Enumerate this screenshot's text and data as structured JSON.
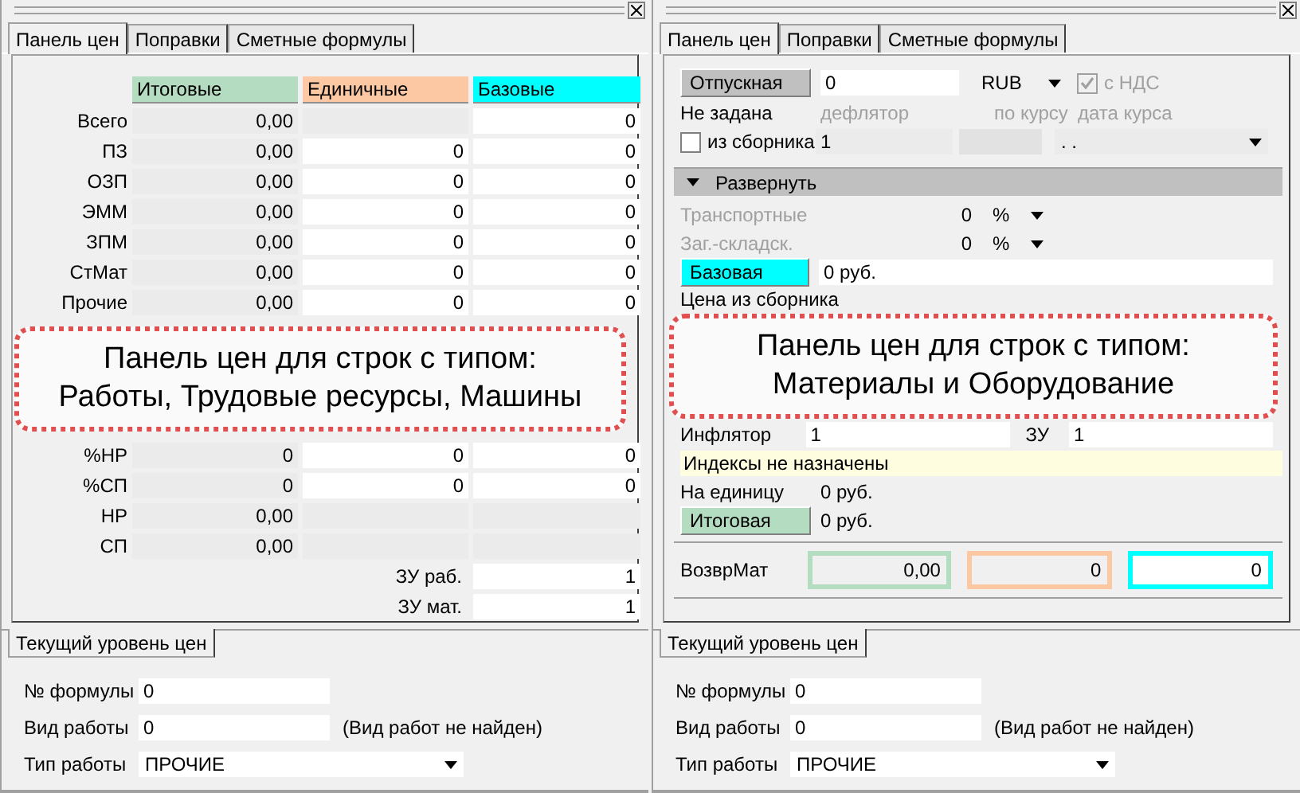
{
  "left_panel": {
    "tabs": [
      {
        "label": "Панель цен",
        "selected": true
      },
      {
        "label": "Поправки",
        "selected": false
      },
      {
        "label": "Сметные формулы",
        "selected": false
      }
    ],
    "columns": [
      {
        "label": "Итоговые",
        "color": "#b4dcc0"
      },
      {
        "label": "Единичные",
        "color": "#fcc8a4"
      },
      {
        "label": "Базовые",
        "color": "#00ffff"
      }
    ],
    "rows": [
      {
        "label": "Всего",
        "total": "0,00",
        "base": "0"
      },
      {
        "label": "ПЗ",
        "total": "0,00",
        "unit": "0",
        "base": "0"
      },
      {
        "label": "ОЗП",
        "total": "0,00",
        "unit": "0",
        "base": "0"
      },
      {
        "label": "ЭММ",
        "total": "0,00",
        "unit": "0",
        "base": "0"
      },
      {
        "label": "ЗПМ",
        "total": "0,00",
        "unit": "0",
        "base": "0"
      },
      {
        "label": "СтМат",
        "total": "0,00",
        "unit": "0",
        "base": "0"
      },
      {
        "label": "Прочие",
        "total": "0,00",
        "unit": "0",
        "base": "0"
      }
    ],
    "callout": "Панель цен для строк с типом:\nРаботы, Трудовые ресурсы, Машины",
    "rows_after": [
      {
        "label": "%НР",
        "total": "0",
        "unit": "0",
        "base": "0"
      },
      {
        "label": "%СП",
        "total": "0",
        "unit": "0",
        "base": "0"
      },
      {
        "label": "НР",
        "total": "0,00"
      },
      {
        "label": "СП",
        "total": "0,00"
      }
    ],
    "factors": [
      {
        "label": "ЗУ раб.",
        "value": "1"
      },
      {
        "label": "ЗУ мат.",
        "value": "1"
      }
    ],
    "bottom_tabs": [
      {
        "label": "Текущий уровень цен",
        "selected": true
      }
    ],
    "formula": {
      "label": "№ формулы",
      "value": "0"
    },
    "work_kind": {
      "label": "Вид работы",
      "value": "0",
      "note": "(Вид работ не найден)"
    },
    "work_type": {
      "label": "Тип работы",
      "value": "ПРОЧИЕ"
    }
  },
  "right_panel": {
    "tabs": [
      {
        "label": "Панель цен",
        "selected": true
      },
      {
        "label": "Поправки",
        "selected": false
      },
      {
        "label": "Сметные формулы",
        "selected": false
      }
    ],
    "price_button": "Отпускная",
    "price_value": "0",
    "currency": "RUB",
    "vat": {
      "label": "с НДС",
      "checked": true,
      "disabled": true
    },
    "status": "Не задана",
    "hints": [
      "дефлятор",
      "по курсу",
      "дата курса"
    ],
    "from_collection": {
      "label": "из сборника",
      "checked": false
    },
    "collection_value": "1",
    "rate_date": ". .",
    "expand": {
      "label": "Развернуть",
      "expanded": false
    },
    "surcharges": [
      {
        "label": "Транспортные",
        "value": "0",
        "unit": "%"
      },
      {
        "label": "Заг.-складск.",
        "value": "0",
        "unit": "%"
      }
    ],
    "base": {
      "label": "Базовая",
      "value": "0 руб.",
      "color": "#00ffff"
    },
    "collection_price_label": "Цена из сборника",
    "callout": "Панель цен для строк с типом:\nМатериалы и Оборудование",
    "inflator": {
      "label": "Инфлятор",
      "value": "1",
      "zu_label": "ЗУ",
      "zu_value": "1"
    },
    "indexes_note": "Индексы не назначены",
    "per_unit": {
      "label": "На единицу",
      "value": "0 руб."
    },
    "total": {
      "label": "Итоговая",
      "value": "0 руб.",
      "color": "#b4dcc0"
    },
    "return_row": {
      "label": "ВозврМат",
      "values": [
        {
          "value": "0,00",
          "color": "#b4dcc0",
          "editable": false
        },
        {
          "value": "0",
          "color": "#fcc8a4",
          "editable": false
        },
        {
          "value": "0",
          "color": "#00ffff",
          "editable": true
        }
      ]
    },
    "bottom_tabs": [
      {
        "label": "Текущий уровень цен",
        "selected": true
      }
    ],
    "formula": {
      "label": "№ формулы",
      "value": "0"
    },
    "work_kind": {
      "label": "Вид работы",
      "value": "0",
      "note": "(Вид работ не найден)"
    },
    "work_type": {
      "label": "Тип работы",
      "value": "ПРОЧИЕ"
    }
  }
}
